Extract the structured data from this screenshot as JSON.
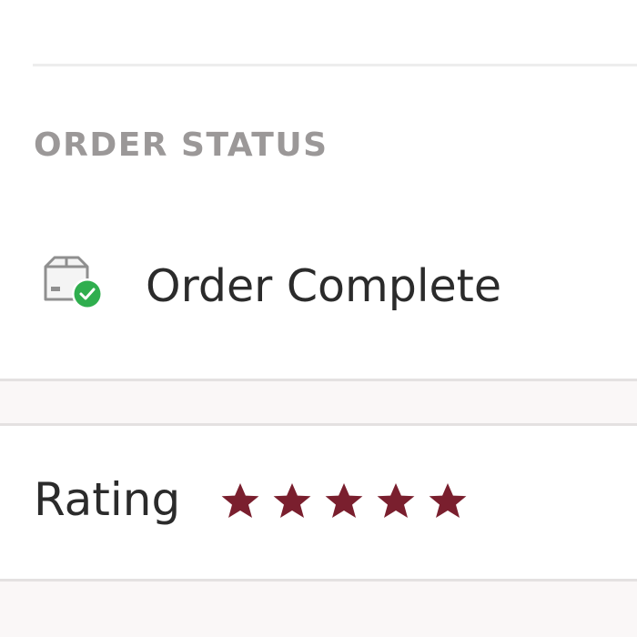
{
  "order_status": {
    "header": "ORDER STATUS",
    "status_label": "Order Complete",
    "icon": "package-check-icon",
    "status_color": "#2fae4e"
  },
  "rating": {
    "label": "Rating",
    "value": 5,
    "max": 5,
    "star_icon": "star-icon",
    "star_color": "#7a1f2e"
  }
}
